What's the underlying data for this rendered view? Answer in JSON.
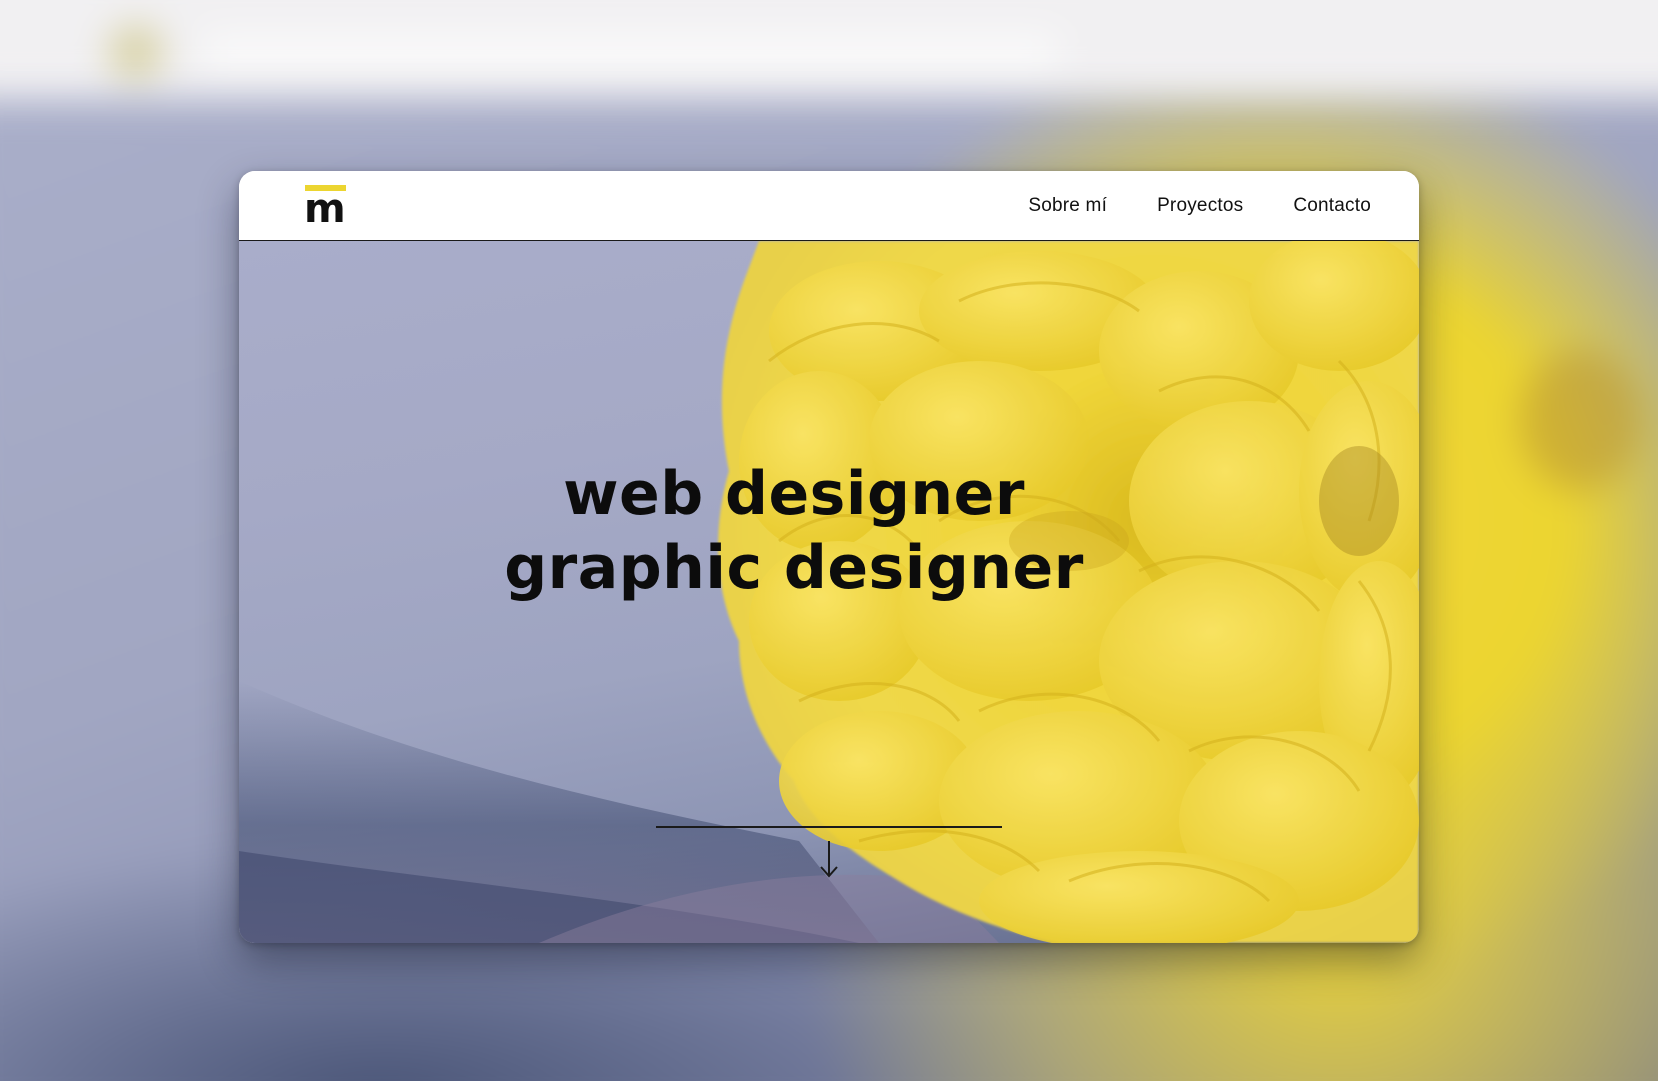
{
  "brand": {
    "logo_letter": "m",
    "accent_color": "#ecd530"
  },
  "nav": {
    "items": [
      {
        "label": "Sobre mí"
      },
      {
        "label": "Proyectos"
      },
      {
        "label": "Contacto"
      }
    ]
  },
  "hero": {
    "line1": "web designer",
    "line2": "graphic designer",
    "scroll_icon": "arrow-down-icon"
  },
  "colors": {
    "background_lavender": "#a5a9c6",
    "flower_yellow": "#ecd530",
    "text": "#0c0c0c"
  }
}
